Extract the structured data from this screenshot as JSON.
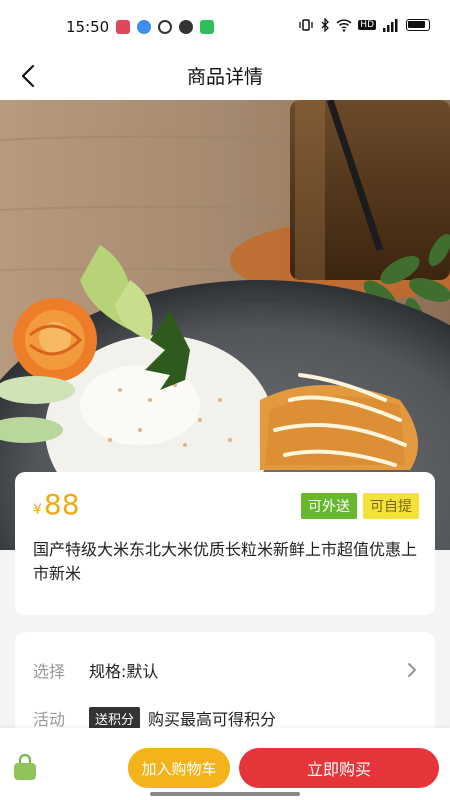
{
  "status_bar": {
    "time": "15:50",
    "network_label": "HD",
    "left_icons": [
      "app-notification-icon",
      "browser-icon",
      "chat-icon",
      "wechat-icon",
      "message-icon"
    ],
    "right_icons": [
      "vibrate-icon",
      "bluetooth-icon",
      "wifi-icon",
      "hd-icon",
      "signal-icon",
      "battery-icon"
    ]
  },
  "nav": {
    "title": "商品详情"
  },
  "product": {
    "currency": "¥",
    "price": "88",
    "tags": {
      "delivery": "可外送",
      "pickup": "可自提"
    },
    "title": "国产特级大米东北大米优质长粒米新鲜上市超值优惠上市新米"
  },
  "specs": {
    "spec_label": "选择",
    "spec_value": "规格:默认",
    "activity_label": "活动",
    "activity_badge": "送积分",
    "activity_text": "购买最高可得积分"
  },
  "bottom": {
    "add_to_cart": "加入购物车",
    "buy_now": "立即购买"
  },
  "colors": {
    "price": "#f4a80f",
    "delivery_tag": "#67b82f",
    "pickup_tag": "#f4e23b",
    "cart_button": "#f4b31a",
    "buy_button": "#e5353a"
  }
}
